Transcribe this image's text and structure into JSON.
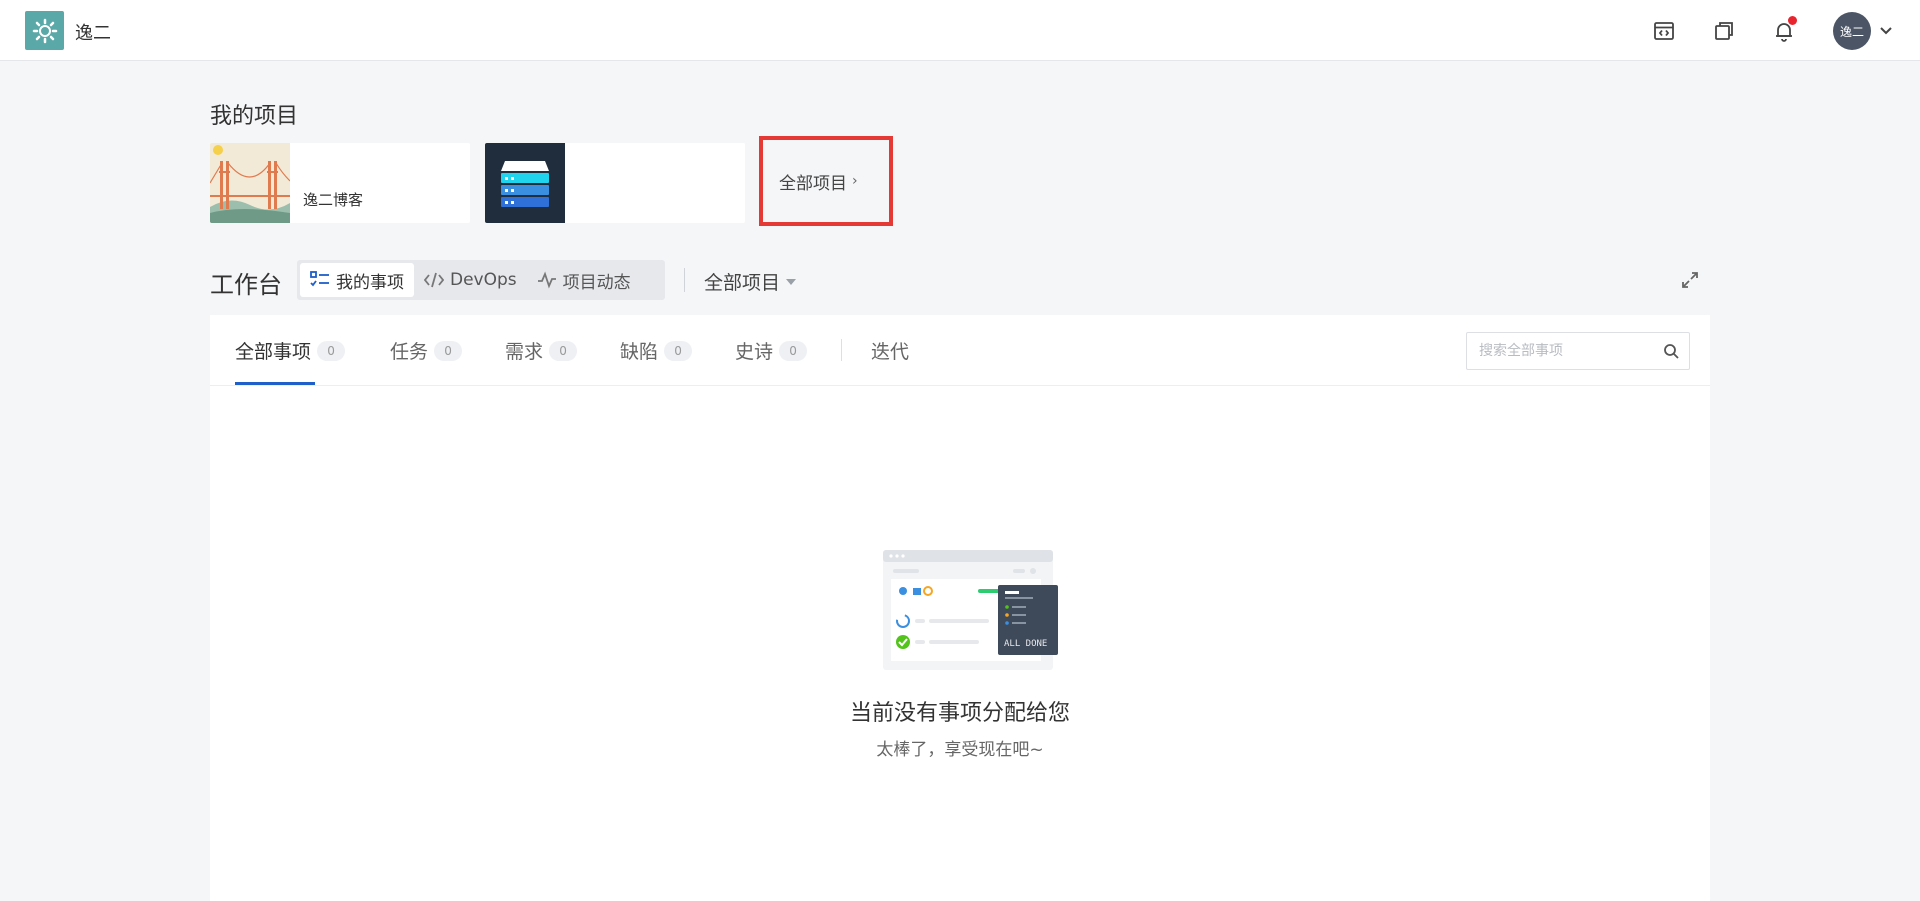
{
  "header": {
    "brand": "逸二",
    "avatar_text": "逸二",
    "icons": [
      "calendar-code-icon",
      "copy-window-icon",
      "bell-icon",
      "chevron-down-icon"
    ],
    "has_unread_notification": true
  },
  "my_projects": {
    "title": "我的项目",
    "cards": [
      {
        "name": "逸二博客",
        "thumb": "bridge-landscape-icon"
      },
      {
        "name": "",
        "thumb": "server-stack-icon"
      }
    ],
    "all_projects_link": "全部项目",
    "highlight_color": "#e53935"
  },
  "workbench": {
    "title": "工作台",
    "segments": [
      {
        "label": "我的事项",
        "icon": "checklist-icon",
        "active": true
      },
      {
        "label": "DevOps",
        "icon": "code-icon",
        "active": false
      },
      {
        "label": "项目动态",
        "icon": "activity-icon",
        "active": false
      }
    ],
    "project_filter": "全部项目"
  },
  "panel": {
    "tabs": [
      {
        "label": "全部事项",
        "count": "0",
        "active": true
      },
      {
        "label": "任务",
        "count": "0"
      },
      {
        "label": "需求",
        "count": "0"
      },
      {
        "label": "缺陷",
        "count": "0"
      },
      {
        "label": "史诗",
        "count": "0"
      },
      {
        "label": "迭代"
      }
    ],
    "search_placeholder": "搜索全部事项",
    "accent": "#1e5fc9",
    "empty": {
      "illustration_text": "ALL DONE",
      "title": "当前没有事项分配给您",
      "subtitle": "太棒了，享受现在吧~"
    }
  }
}
